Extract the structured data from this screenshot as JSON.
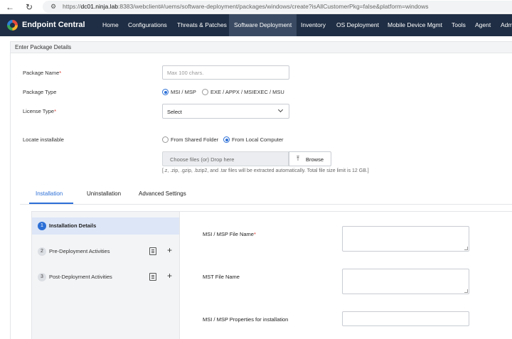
{
  "browser": {
    "url_prefix": "https://",
    "url_host": "dc01.ninja.lab",
    "url_rest": ":8383/webclient#/uems/software-deployment/packages/windows/create?isAllCustomerPkg=false&platform=windows"
  },
  "app": {
    "brand": "Endpoint Central",
    "nav": [
      {
        "label": "Home"
      },
      {
        "label": "Configurations"
      },
      {
        "label": "Threats & Patches"
      },
      {
        "label": "Software Deployment",
        "active": true
      },
      {
        "label": "Inventory"
      },
      {
        "label": "OS Deployment"
      },
      {
        "label": "Mobile Device Mgmt"
      },
      {
        "label": "Tools"
      },
      {
        "label": "Agent"
      },
      {
        "label": "Adm"
      }
    ]
  },
  "section": {
    "title": "Enter Package Details"
  },
  "form": {
    "package_name": {
      "label": "Package Name",
      "required": "*",
      "placeholder": "Max 100 chars."
    },
    "package_type": {
      "label": "Package Type",
      "options": [
        "MSI / MSP",
        "EXE / APPX / MSIEXEC / MSU"
      ],
      "selected": "MSI / MSP"
    },
    "license_type": {
      "label": "License Type",
      "required": "*",
      "value": "Select"
    },
    "locate": {
      "label": "Locate installable",
      "options": [
        "From Shared Folder",
        "From Local Computer"
      ],
      "selected": "From Local Computer",
      "drop_text": "Choose files (or) Drop here",
      "browse_label": "Browse",
      "hint": "[.z, .zip, .gzip, .bzip2, and .tar files will be extracted automatically. Total file size limit is 12 GB.]"
    }
  },
  "tabs": [
    {
      "label": "Installation",
      "active": true
    },
    {
      "label": "Uninstallation"
    },
    {
      "label": "Advanced Settings"
    }
  ],
  "steps": [
    {
      "num": "1",
      "label": "Installation Details",
      "active": true
    },
    {
      "num": "2",
      "label": "Pre-Deployment Activities"
    },
    {
      "num": "3",
      "label": "Post-Deployment Activities"
    }
  ],
  "install_details": {
    "msi_file_label": "MSI / MSP File Name",
    "msi_file_required": "*",
    "mst_file_label": "MST File Name",
    "msi_props_label": "MSI / MSP Properties for installation"
  },
  "colors": {
    "nav_bg": "#1f2e44",
    "accent": "#2c6fd6",
    "required": "#d9342b"
  }
}
